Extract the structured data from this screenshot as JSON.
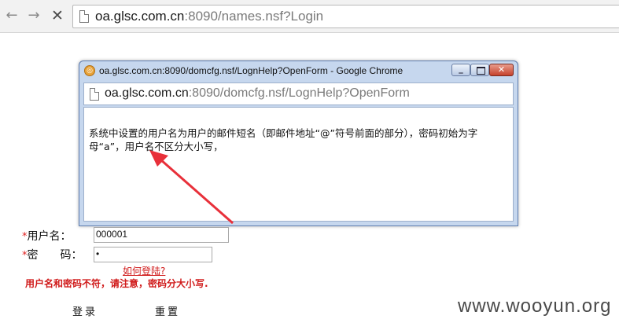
{
  "browser": {
    "back_icon": "arrow-left-icon",
    "forward_icon": "arrow-right-icon",
    "stop_icon": "close-icon",
    "url_host": "oa.glsc.com.cn",
    "url_rest": ":8090/names.nsf?Login"
  },
  "popup": {
    "title": "oa.glsc.com.cn:8090/domcfg.nsf/LognHelp?OpenForm - Google Chrome",
    "url_host": "oa.glsc.com.cn",
    "url_rest": ":8090/domcfg.nsf/LognHelp?OpenForm",
    "help_text": "系统中设置的用户名为用户的邮件短名（即邮件地址“@”符号前面的部分），密码初始为字母“a”，用户名不区分大小写，"
  },
  "login_form": {
    "required_mark": "*",
    "username_label": "用户名：",
    "username_value": "000001",
    "password_label": "密　　码：",
    "password_value": "•",
    "help_link": "如何登陆?",
    "error_message": "用户名和密码不符，请注意，密码分大小写.",
    "login_button": "登录",
    "reset_button": "重置"
  },
  "watermark": "www.wooyun.org",
  "colors": {
    "error_red": "#d01a1a",
    "arrow_red": "#e8303a",
    "titlebar_blue": "#c6d7ee"
  }
}
